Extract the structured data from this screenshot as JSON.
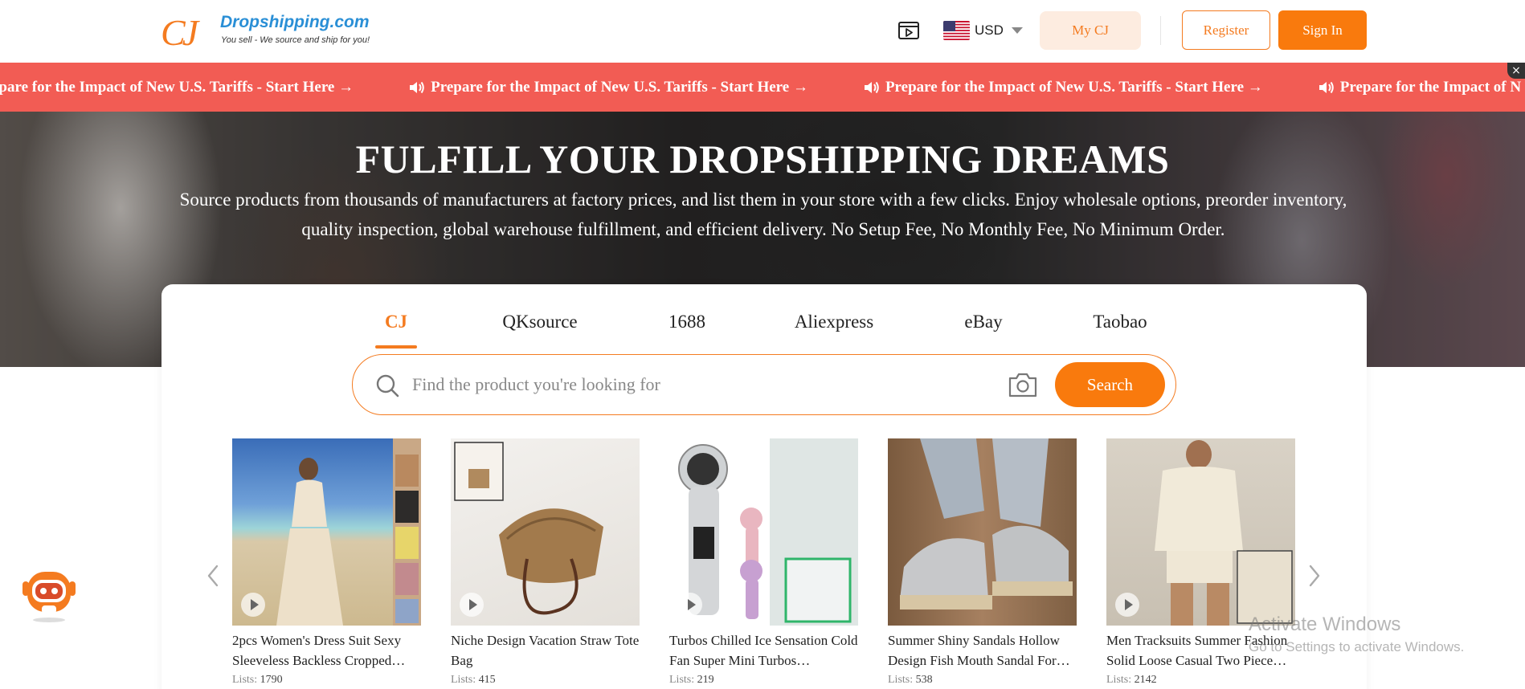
{
  "header": {
    "logo_mark": "CJ",
    "logo_name": "Dropshipping.com",
    "logo_tagline": "You sell - We source and ship for you!",
    "currency": "USD",
    "my_cj": "My CJ",
    "register": "Register",
    "sign_in": "Sign In"
  },
  "banner": {
    "items": [
      "epare for the Impact of New U.S. Tariffs - Start Here →",
      "Prepare for the Impact of New U.S. Tariffs - Start Here →",
      "Prepare for the Impact of New U.S. Tariffs - Start Here →",
      "Prepare for the Impact of N"
    ],
    "close": "×"
  },
  "hero": {
    "title": "FULFILL YOUR DROPSHIPPING DREAMS",
    "subtitle": "Source products from thousands of manufacturers at factory prices, and list them in your store with a few clicks. Enjoy wholesale options, preorder inventory, quality inspection, global warehouse fulfillment, and efficient delivery. No Setup Fee, No Monthly Fee, No Minimum Order."
  },
  "search": {
    "tabs": [
      "CJ",
      "QKsource",
      "1688",
      "Aliexpress",
      "eBay",
      "Taobao"
    ],
    "active_tab": "CJ",
    "placeholder": "Find the product you're looking for",
    "button": "Search"
  },
  "products": [
    {
      "title": "2pcs Women's Dress Suit Sexy Sleeveless Backless Cropped…",
      "lists_label": "Lists:",
      "lists": "1790"
    },
    {
      "title": "Niche Design Vacation Straw Tote Bag",
      "lists_label": "Lists:",
      "lists": "415"
    },
    {
      "title": "Turbos Chilled Ice Sensation Cold Fan Super Mini Turbos…",
      "lists_label": "Lists:",
      "lists": "219"
    },
    {
      "title": "Summer Shiny Sandals Hollow Design Fish Mouth Sandal For…",
      "lists_label": "Lists:",
      "lists": "538"
    },
    {
      "title": "Men Tracksuits Summer Fashion Solid Loose Casual Two Piece…",
      "lists_label": "Lists:",
      "lists": "2142"
    }
  ],
  "watermark": {
    "line1": "Activate Windows",
    "line2": "Go to Settings to activate Windows."
  },
  "colors": {
    "brand_orange": "#f97a0d",
    "banner_red": "#f25c54",
    "logo_blue": "#2a8fd6"
  }
}
